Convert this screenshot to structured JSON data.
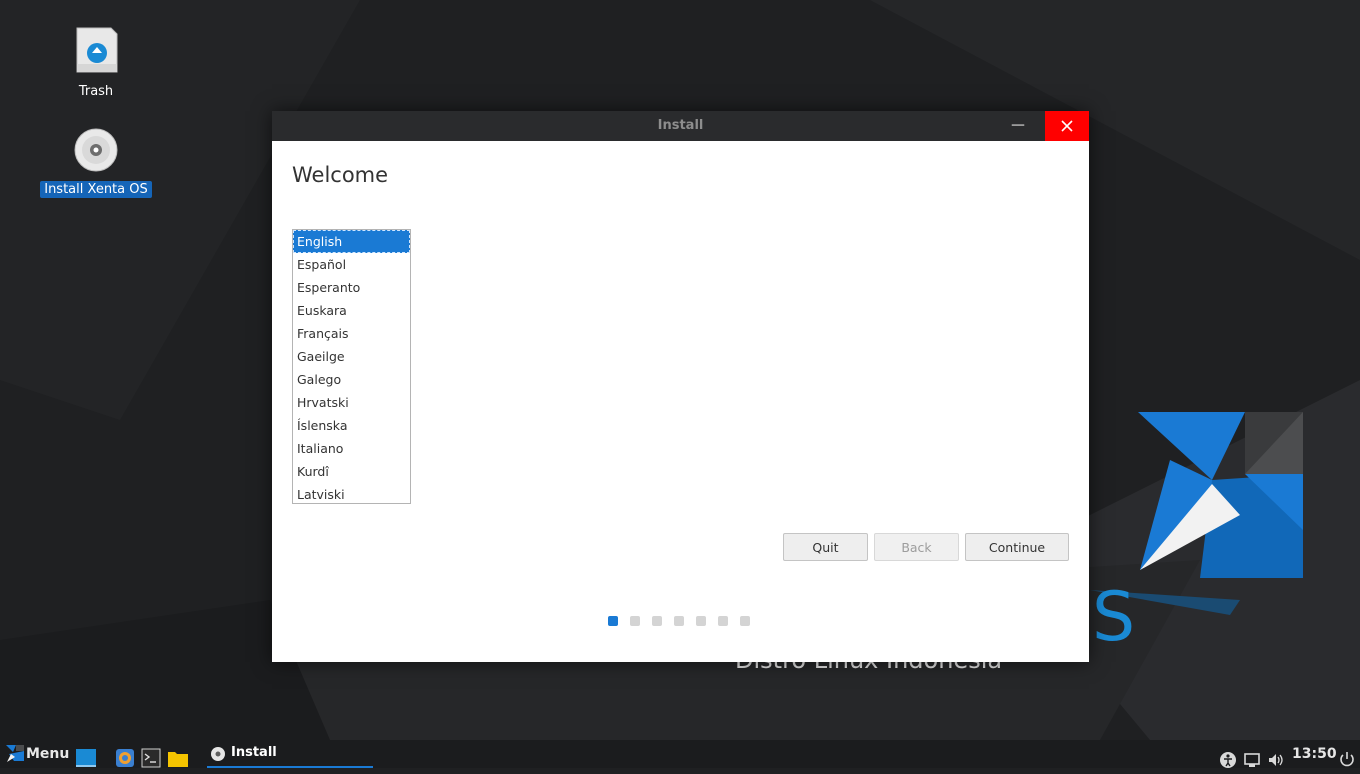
{
  "desktop": {
    "icons": [
      {
        "label": "Trash"
      },
      {
        "label": "Install Xenta OS"
      }
    ],
    "wallpaper_text": "Distro Linux Indonesia",
    "accent": "#1a7ad4"
  },
  "window": {
    "title": "Install",
    "minimize_glyph": "—",
    "heading": "Welcome",
    "languages": [
      "English",
      "Español",
      "Esperanto",
      "Euskara",
      "Français",
      "Gaeilge",
      "Galego",
      "Hrvatski",
      "Íslenska",
      "Italiano",
      "Kurdî",
      "Latviski"
    ],
    "selected_language": "English",
    "buttons": {
      "quit": "Quit",
      "back": "Back",
      "continue": "Continue"
    },
    "steps": {
      "total": 7,
      "current": 1
    }
  },
  "taskbar": {
    "menu_label": "Menu",
    "task_label": "Install",
    "clock": "13:50",
    "tray_icons": [
      "accessibility-icon",
      "network-icon",
      "volume-icon",
      "power-icon"
    ]
  }
}
